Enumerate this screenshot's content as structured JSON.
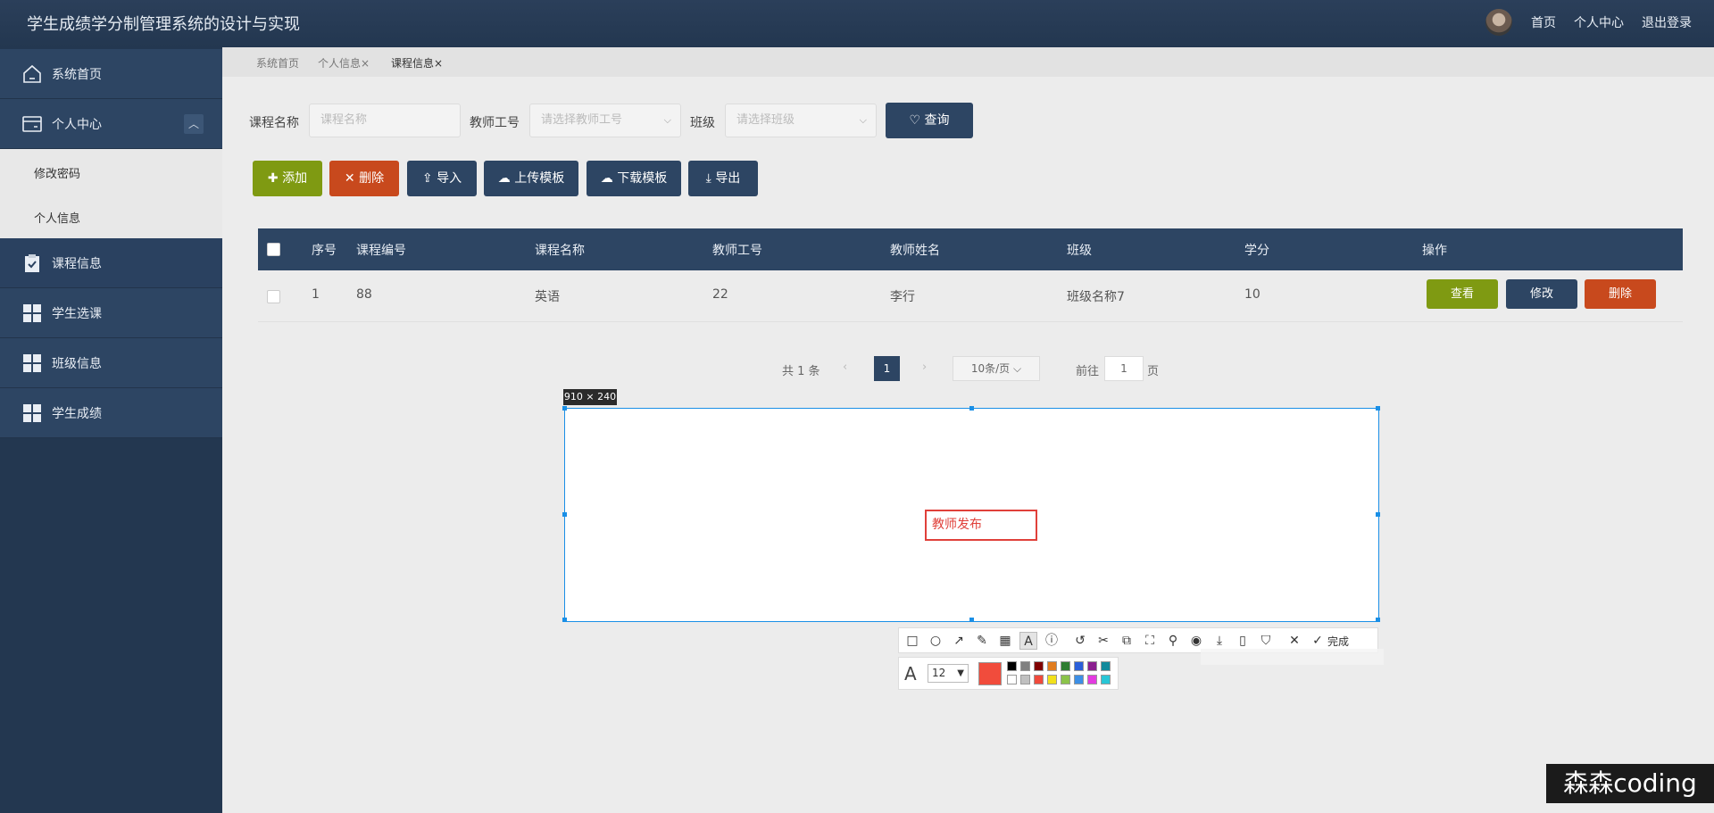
{
  "header": {
    "title": "学生成绩学分制管理系统的设计与实现",
    "links": [
      "首页",
      "个人中心",
      "退出登录"
    ]
  },
  "sidebar": {
    "home": "系统首页",
    "personal": "个人中心",
    "personal_sub": [
      "修改密码",
      "个人信息"
    ],
    "items": [
      "课程信息",
      "学生选课",
      "班级信息",
      "学生成绩"
    ]
  },
  "tabs": [
    "系统首页",
    "个人信息",
    "课程信息"
  ],
  "filters": {
    "course_name_label": "课程名称",
    "course_name_placeholder": "课程名称",
    "teacher_no_label": "教师工号",
    "teacher_no_placeholder": "请选择教师工号",
    "class_label": "班级",
    "class_placeholder": "请选择班级",
    "query_button": "查询"
  },
  "actions": {
    "add": "添加",
    "delete": "删除",
    "import": "导入",
    "upload_template": "上传模板",
    "download_template": "下载模板",
    "export": "导出"
  },
  "table": {
    "headers": [
      "序号",
      "课程编号",
      "课程名称",
      "教师工号",
      "教师姓名",
      "班级",
      "学分",
      "操作"
    ],
    "rows": [
      {
        "index": "1",
        "course_no": "88",
        "course_name": "英语",
        "teacher_no": "22",
        "teacher_name": "李行",
        "class": "班级名称7",
        "credit": "10"
      }
    ],
    "row_actions": {
      "view": "查看",
      "edit": "修改",
      "delete": "删除"
    }
  },
  "pagination": {
    "total": "共 1 条",
    "current": "1",
    "page_size": "10条/页",
    "goto_prefix": "前往",
    "goto_value": "1",
    "goto_suffix": "页"
  },
  "capture": {
    "size_label": "910 × 240",
    "text": "教师发布",
    "font_size": "12",
    "done": "完成",
    "current_color": "#f14c3c",
    "palette": [
      "#000000",
      "#808080",
      "#800000",
      "#e07c1e",
      "#2f7d32",
      "#2b5fd9",
      "#8a1f8f",
      "#138a9c",
      "#ffffff",
      "#c0c0c0",
      "#f04a3c",
      "#f2e11b",
      "#8bc34a",
      "#3d8fe6",
      "#e33be0",
      "#29c6d6"
    ]
  },
  "watermark": "森森coding"
}
